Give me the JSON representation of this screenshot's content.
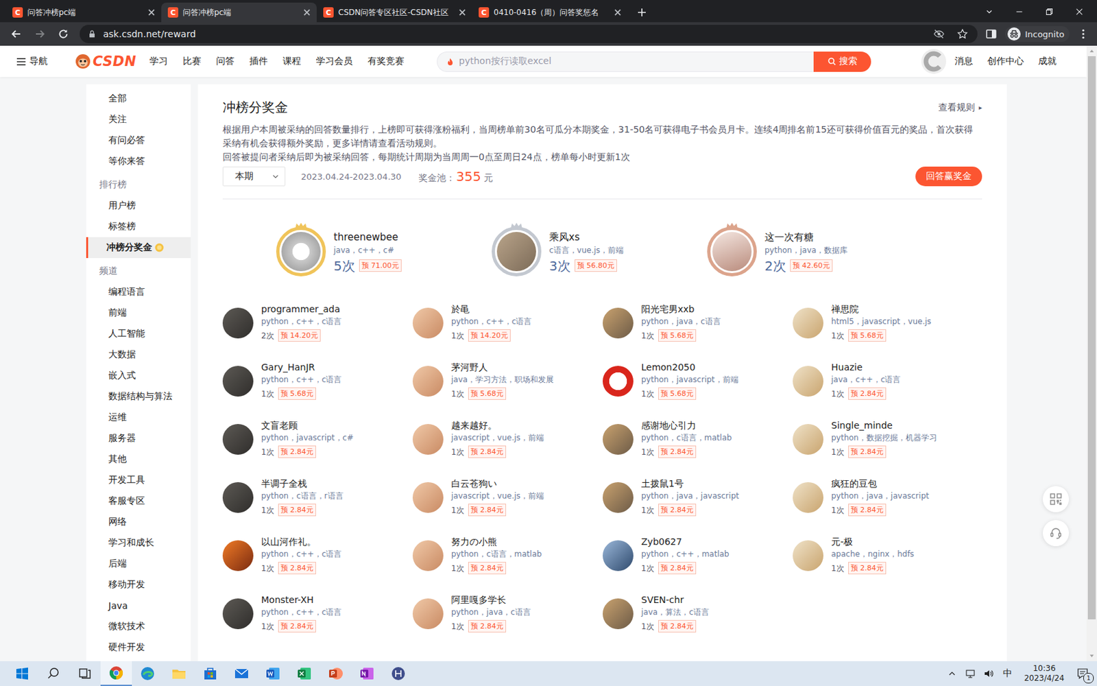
{
  "browser": {
    "tabs": [
      {
        "icon": "C",
        "label": "问答冲榜pc端",
        "selected": false
      },
      {
        "icon": "C",
        "label": "问答冲榜pc端",
        "selected": true
      },
      {
        "icon": "C",
        "label": "CSDN问答专区社区-CSDN社区",
        "selected": false
      },
      {
        "icon": "C",
        "label": "0410-0416（周）问答奖惩名",
        "selected": false
      }
    ],
    "address": "ask.csdn.net/reward",
    "profile": "Incognito"
  },
  "header": {
    "menu": "导航",
    "logo": "CSDN",
    "nav": [
      "学习",
      "比赛",
      "问答",
      "插件",
      "课程",
      "学习会员",
      "有奖竞赛"
    ],
    "search_placeholder": "python按行读取excel",
    "search_button": "搜索",
    "links": [
      "消息",
      "创作中心",
      "成就"
    ]
  },
  "sidebar": {
    "top": [
      {
        "label": "全部",
        "selected": false,
        "badge": false
      },
      {
        "label": "关注",
        "selected": false,
        "badge": false
      },
      {
        "label": "有问必答",
        "selected": false,
        "badge": false
      },
      {
        "label": "等你来答",
        "selected": false,
        "badge": false
      }
    ],
    "sections": [
      {
        "title": "排行榜",
        "items": [
          {
            "label": "用户榜",
            "selected": false,
            "badge": false
          },
          {
            "label": "标签榜",
            "selected": false,
            "badge": false
          },
          {
            "label": "冲榜分奖金",
            "selected": true,
            "badge": true
          }
        ]
      },
      {
        "title": "频道",
        "items": [
          {
            "label": "编程语言",
            "selected": false,
            "badge": false
          },
          {
            "label": "前端",
            "selected": false,
            "badge": false
          },
          {
            "label": "人工智能",
            "selected": false,
            "badge": false
          },
          {
            "label": "大数据",
            "selected": false,
            "badge": false
          },
          {
            "label": "嵌入式",
            "selected": false,
            "badge": false
          },
          {
            "label": "数据结构与算法",
            "selected": false,
            "badge": false
          },
          {
            "label": "运维",
            "selected": false,
            "badge": false
          },
          {
            "label": "服务器",
            "selected": false,
            "badge": false
          },
          {
            "label": "其他",
            "selected": false,
            "badge": false
          },
          {
            "label": "开发工具",
            "selected": false,
            "badge": false
          },
          {
            "label": "客服专区",
            "selected": false,
            "badge": false
          },
          {
            "label": "网络",
            "selected": false,
            "badge": false
          },
          {
            "label": "学习和成长",
            "selected": false,
            "badge": false
          },
          {
            "label": "后端",
            "selected": false,
            "badge": false
          },
          {
            "label": "移动开发",
            "selected": false,
            "badge": false
          },
          {
            "label": "Java",
            "selected": false,
            "badge": false
          },
          {
            "label": "微软技术",
            "selected": false,
            "badge": false
          },
          {
            "label": "硬件开发",
            "selected": false,
            "badge": false
          }
        ]
      }
    ]
  },
  "reward": {
    "title": "冲榜分奖金",
    "rules_link": "查看规则",
    "rules_arrow": "▸",
    "description": [
      "根据用户本周被采纳的回答数量排行，上榜即可获得涨粉福利，当周榜单前30名可瓜分本期奖金，31-50名可获得电子书会员月卡。连续4周排名前15还可获得价值百元的奖品，首次获得采纳有机会获得额外奖励，更多详情请查看活动规则。",
      "回答被提问者采纳后即为被采纳回答，每期统计周期为当周周一0点至周日24点，榜单每小时更新1次"
    ],
    "period": "本期",
    "date_range": "2023.04.24-2023.04.30",
    "pool_label": "奖金池：",
    "pool_amount": "355",
    "pool_unit": "元",
    "cta": "回答赢奖金"
  },
  "podium": [
    {
      "name": "threenewbee",
      "tags": "java，c++，c#",
      "count": "5次",
      "reward": "预 71.00元",
      "color": "#f0c45a"
    },
    {
      "name": "乘风xs",
      "tags": "c语言，vue.js，前端",
      "count": "3次",
      "reward": "预 56.80元",
      "color": "#c3c8d0"
    },
    {
      "name": "这一次有糖",
      "tags": "python，java，数据库",
      "count": "2次",
      "reward": "预 42.60元",
      "color": "#dca48c"
    }
  ],
  "users": [
    {
      "name": "programmer_ada",
      "tags": "python，c++，c语言",
      "count": "2次",
      "reward": "预 14.20元"
    },
    {
      "name": "於黾",
      "tags": "python，c++，c语言",
      "count": "1次",
      "reward": "预 14.20元"
    },
    {
      "name": "阳光宅男xxb",
      "tags": "python，java，c语言",
      "count": "1次",
      "reward": "预 5.68元"
    },
    {
      "name": "禅思院",
      "tags": "html5，javascript，vue.js",
      "count": "1次",
      "reward": "预 5.68元"
    },
    {
      "name": "Gary_HanJR",
      "tags": "python，c++，c语言",
      "count": "1次",
      "reward": "预 5.68元"
    },
    {
      "name": "茅河野人",
      "tags": "java，学习方法，职场和发展",
      "count": "1次",
      "reward": "预 5.68元"
    },
    {
      "name": "Lemon2050",
      "tags": "python，javascript，前端",
      "count": "1次",
      "reward": "预 5.68元"
    },
    {
      "name": "Huazie",
      "tags": "java，c++，c语言",
      "count": "1次",
      "reward": "预 2.84元"
    },
    {
      "name": "文盲老顾",
      "tags": "python，javascript，c#",
      "count": "1次",
      "reward": "预 2.84元"
    },
    {
      "name": "越来越好。",
      "tags": "javascript，vue.js，前端",
      "count": "1次",
      "reward": "预 2.84元"
    },
    {
      "name": "感谢地心引力",
      "tags": "python，c语言，matlab",
      "count": "1次",
      "reward": "预 2.84元"
    },
    {
      "name": "Single_minde",
      "tags": "python，数据挖掘，机器学习",
      "count": "1次",
      "reward": "预 2.84元"
    },
    {
      "name": "半调子全栈",
      "tags": "python，c语言，r语言",
      "count": "1次",
      "reward": "预 2.84元"
    },
    {
      "name": "白云苍狗い",
      "tags": "javascript，vue.js，前端",
      "count": "1次",
      "reward": "预 2.84元"
    },
    {
      "name": "土拨鼠1号",
      "tags": "python，java，javascript",
      "count": "1次",
      "reward": "预 2.84元"
    },
    {
      "name": "疯狂的豆包",
      "tags": "python，java，javascript",
      "count": "1次",
      "reward": "预 2.84元"
    },
    {
      "name": "以山河作礼。",
      "tags": "python，c++，c语言",
      "count": "1次",
      "reward": "预 2.84元"
    },
    {
      "name": "努力の小熊",
      "tags": "python，c语言，matlab",
      "count": "1次",
      "reward": "预 2.84元"
    },
    {
      "name": "Zyb0627",
      "tags": "python，c++，matlab",
      "count": "1次",
      "reward": "预 2.84元"
    },
    {
      "name": "元-极",
      "tags": "apache，nginx，hdfs",
      "count": "1次",
      "reward": "预 2.84元"
    },
    {
      "name": "Monster-XH",
      "tags": "python，c++，c语言",
      "count": "1次",
      "reward": "预 2.84元"
    },
    {
      "name": "阿里嘎多学长",
      "tags": "python，java，c语言",
      "count": "1次",
      "reward": "预 2.84元"
    },
    {
      "name": "SVEN-chr",
      "tags": "java，算法，c语言",
      "count": "1次",
      "reward": "预 2.84元"
    }
  ],
  "taskbar": {
    "ime": "中",
    "time": "10:36",
    "date": "2023/4/24",
    "notifications": "1"
  }
}
